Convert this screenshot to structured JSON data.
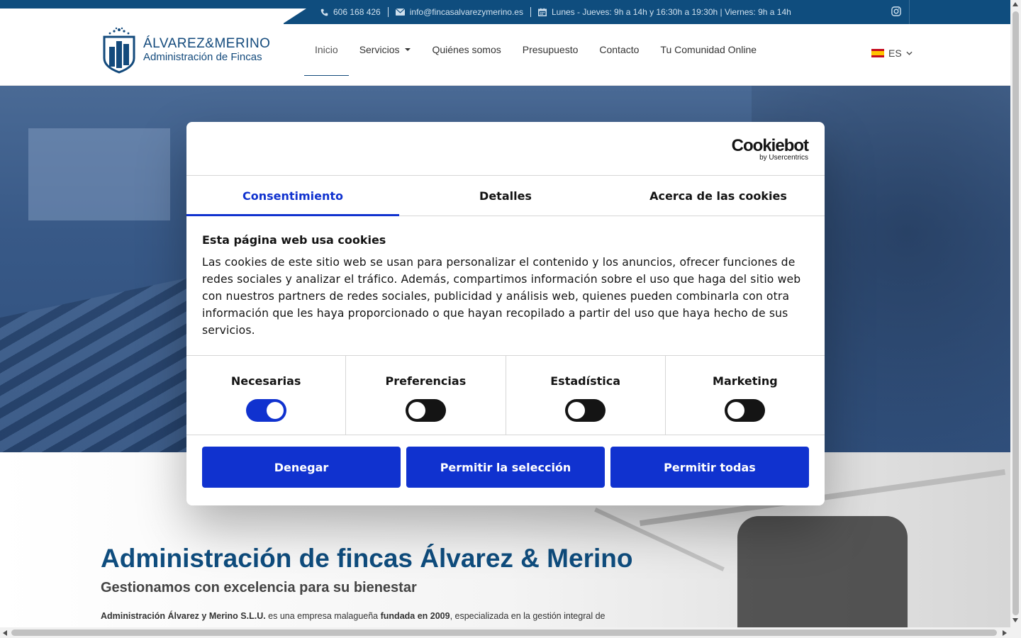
{
  "topbar": {
    "phone": "606 168 426",
    "email": "info@fincasalvarezymerino.es",
    "hours": "Lunes - Jueves: 9h a 14h y 16:30h a 19:30h | Viernes: 9h a 14h"
  },
  "logo": {
    "title": "ÁLVAREZ&MERINO",
    "subtitle": "Administración de Fincas"
  },
  "nav": {
    "items": [
      "Inicio",
      "Servicios",
      "Quiénes somos",
      "Presupuesto",
      "Contacto",
      "Tu Comunidad Online"
    ],
    "active": "Inicio"
  },
  "language": {
    "code": "ES"
  },
  "cookie": {
    "brand": "Cookiebot",
    "brand_sub": "by Usercentrics",
    "tabs": [
      "Consentimiento",
      "Detalles",
      "Acerca de las cookies"
    ],
    "heading": "Esta página web usa cookies",
    "body": "Las cookies de este sitio web se usan para personalizar el contenido y los anuncios, ofrecer funciones de redes sociales y analizar el tráfico. Además, compartimos información sobre el uso que haga del sitio web con nuestros partners de redes sociales, publicidad y análisis web, quienes pueden combinarla con otra información que les haya proporcionado o que hayan recopilado a partir del uso que haya hecho de sus servicios.",
    "categories": [
      {
        "label": "Necesarias",
        "checked": true
      },
      {
        "label": "Preferencias",
        "checked": false
      },
      {
        "label": "Estadística",
        "checked": false
      },
      {
        "label": "Marketing",
        "checked": false
      }
    ],
    "buttons": [
      "Denegar",
      "Permitir la selección",
      "Permitir todas"
    ],
    "accent": "#1032cf"
  },
  "page": {
    "title": "Administración de fincas Álvarez & Merino",
    "subtitle": "Gestionamos con excelencia para su bienestar",
    "intro_company": "Administración Álvarez y Merino S.L.U.",
    "intro_mid": " es una empresa malagueña ",
    "intro_founded": "fundada en 2009",
    "intro_end": ", especializada en la gestión integral de"
  },
  "colors": {
    "brand": "#0f4d7e"
  }
}
